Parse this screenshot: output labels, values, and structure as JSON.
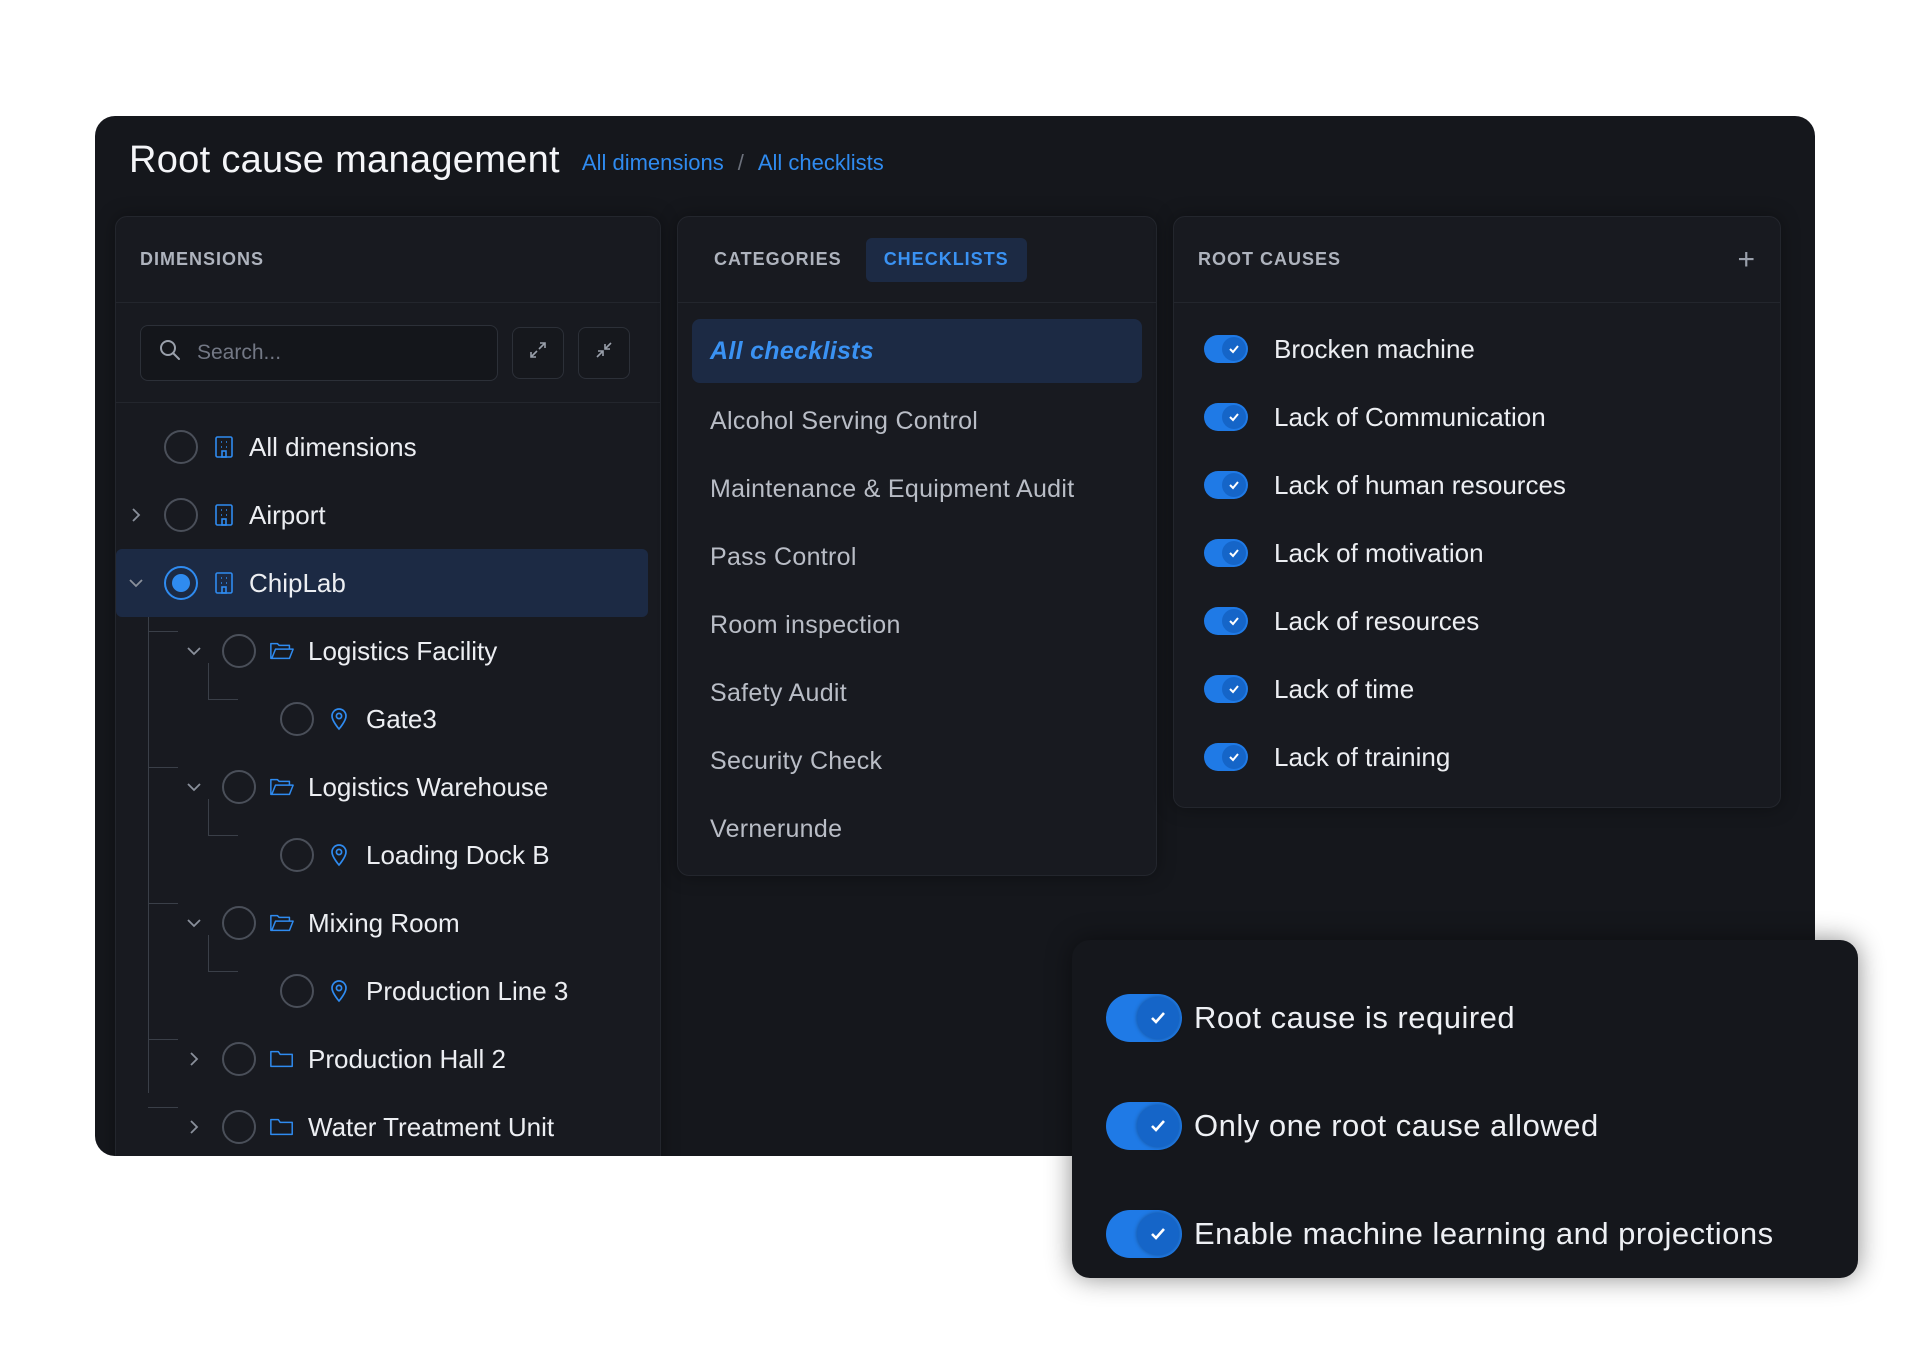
{
  "header": {
    "title": "Root cause management",
    "breadcrumb": [
      "All dimensions",
      "All checklists"
    ],
    "separator": "/"
  },
  "dimensions": {
    "heading": "DIMENSIONS",
    "search_placeholder": "Search...",
    "tree": [
      {
        "label": "All dimensions",
        "icon": "building-icon",
        "selected": false
      },
      {
        "label": "Airport",
        "icon": "building-icon",
        "selected": false
      },
      {
        "label": "ChipLab",
        "icon": "building-icon",
        "selected": true
      },
      {
        "label": "Logistics Facility",
        "icon": "folder-open-icon",
        "selected": false
      },
      {
        "label": "Gate3",
        "icon": "location-pin-icon",
        "selected": false
      },
      {
        "label": "Logistics Warehouse",
        "icon": "folder-open-icon",
        "selected": false
      },
      {
        "label": "Loading Dock B",
        "icon": "location-pin-icon",
        "selected": false
      },
      {
        "label": "Mixing Room",
        "icon": "folder-open-icon",
        "selected": false
      },
      {
        "label": "Production Line 3",
        "icon": "location-pin-icon",
        "selected": false
      },
      {
        "label": "Production Hall 2",
        "icon": "folder-icon",
        "selected": false
      },
      {
        "label": "Water Treatment Unit",
        "icon": "folder-icon",
        "selected": false
      }
    ]
  },
  "checklists": {
    "tabs": [
      "CATEGORIES",
      "CHECKLISTS"
    ],
    "active_tab": "CHECKLISTS",
    "items": [
      "All checklists",
      "Alcohol Serving Control",
      "Maintenance & Equipment Audit",
      "Pass Control",
      "Room inspection",
      "Safety Audit",
      "Security Check",
      "Vernerunde"
    ]
  },
  "root_causes": {
    "heading": "ROOT CAUSES",
    "add_label": "+",
    "items": [
      "Brocken machine",
      "Lack of Communication",
      "Lack of human resources",
      "Lack of motivation",
      "Lack of resources",
      "Lack of time",
      "Lack of training"
    ]
  },
  "settings": {
    "items": [
      "Root cause is required",
      "Only one root cause allowed",
      "Enable machine learning and projections"
    ]
  },
  "colors": {
    "accent": "#2f8bf0",
    "background": "#15171c",
    "selected_bg": "#1c2a44"
  }
}
